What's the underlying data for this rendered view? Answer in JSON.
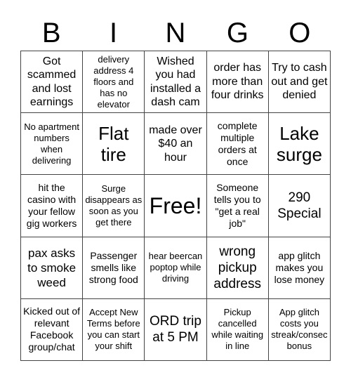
{
  "header": [
    "B",
    "I",
    "N",
    "G",
    "O"
  ],
  "cells": [
    {
      "text": "Got scammed and lost earnings",
      "size": "s16"
    },
    {
      "text": "delivery address 4 floors and has no elevator",
      "size": "s13"
    },
    {
      "text": "Wished you had installed a dash cam",
      "size": "s16"
    },
    {
      "text": "order has more than four drinks",
      "size": "s16"
    },
    {
      "text": "Try to cash out and get denied",
      "size": "s16"
    },
    {
      "text": "No apartment numbers when delivering",
      "size": "s13"
    },
    {
      "text": "Flat tire",
      "size": "s26"
    },
    {
      "text": "made over $40 an hour",
      "size": "s16"
    },
    {
      "text": "complete multiple orders at once",
      "size": "s14"
    },
    {
      "text": "Lake surge",
      "size": "s26"
    },
    {
      "text": "hit the casino with your fellow gig workers",
      "size": "s14"
    },
    {
      "text": "Surge disappears as soon as you get there",
      "size": "s13"
    },
    {
      "text": "Free!",
      "size": "s32"
    },
    {
      "text": "Someone tells you to \"get a real job\"",
      "size": "s14"
    },
    {
      "text": "290 Special",
      "size": "s19"
    },
    {
      "text": "pax asks to smoke weed",
      "size": "s17"
    },
    {
      "text": "Passenger smells like strong food",
      "size": "s14"
    },
    {
      "text": "hear beercan poptop while driving",
      "size": "s13"
    },
    {
      "text": "wrong pickup address",
      "size": "s19"
    },
    {
      "text": "app glitch makes you lose money",
      "size": "s14"
    },
    {
      "text": "Kicked out of relevant Facebook group/chat",
      "size": "s14"
    },
    {
      "text": "Accept New Terms before you can start your shift",
      "size": "s13"
    },
    {
      "text": "ORD trip at 5 PM",
      "size": "s19"
    },
    {
      "text": "Pickup cancelled while waiting in line",
      "size": "s13"
    },
    {
      "text": "App glitch costs you streak/consec bonus",
      "size": "s13"
    }
  ]
}
